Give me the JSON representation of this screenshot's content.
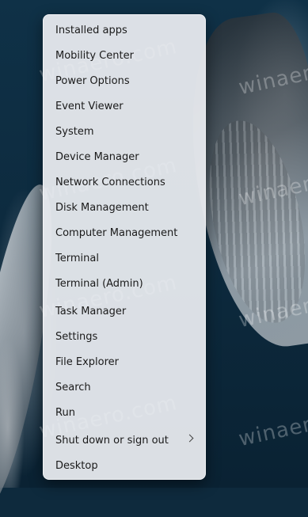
{
  "watermark": "winaero.com",
  "menu": {
    "items": [
      {
        "label": "Installed apps"
      },
      {
        "label": "Mobility Center"
      },
      {
        "label": "Power Options"
      },
      {
        "label": "Event Viewer"
      },
      {
        "label": "System"
      },
      {
        "label": "Device Manager"
      },
      {
        "label": "Network Connections"
      },
      {
        "label": "Disk Management"
      },
      {
        "label": "Computer Management"
      },
      {
        "label": "Terminal"
      },
      {
        "label": "Terminal (Admin)"
      },
      {
        "label": "Task Manager"
      },
      {
        "label": "Settings"
      },
      {
        "label": "File Explorer"
      },
      {
        "label": "Search"
      },
      {
        "label": "Run"
      },
      {
        "label": "Shut down or sign out",
        "submenu_icon": "chevron-right-icon"
      },
      {
        "label": "Desktop"
      }
    ]
  }
}
